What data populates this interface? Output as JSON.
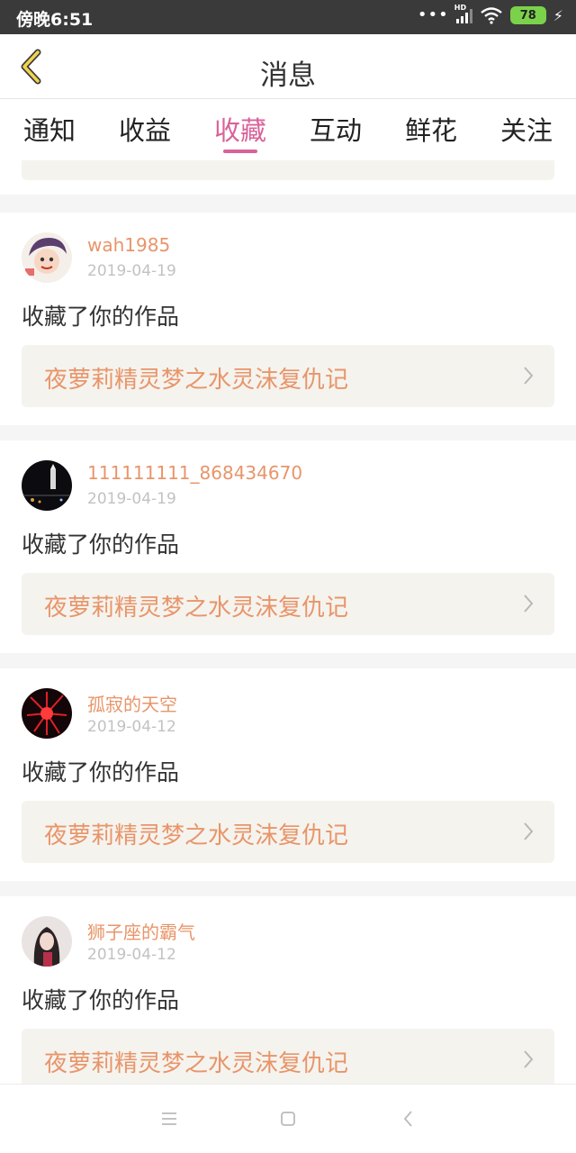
{
  "status": {
    "time": "傍晚6:51",
    "dots": "•••",
    "hd": "HD",
    "battery": "78"
  },
  "header": {
    "title": "消息",
    "back_icon": "chevron-left-icon"
  },
  "tabs": [
    {
      "label": "通知",
      "active": false
    },
    {
      "label": "收益",
      "active": false
    },
    {
      "label": "收藏",
      "active": true
    },
    {
      "label": "互动",
      "active": false
    },
    {
      "label": "鲜花",
      "active": false
    },
    {
      "label": "关注",
      "active": false
    }
  ],
  "accent_colors": {
    "tab_active": "#d9629a",
    "link": "#e8956a"
  },
  "items": [
    {
      "username": "wah1985",
      "date": "2019-04-19",
      "action": "收藏了你的作品",
      "work": "夜萝莉精灵梦之水灵沫复仇记"
    },
    {
      "username": "111111111_868434670",
      "date": "2019-04-19",
      "action": "收藏了你的作品",
      "work": "夜萝莉精灵梦之水灵沫复仇记"
    },
    {
      "username": "孤寂的天空",
      "date": "2019-04-12",
      "action": "收藏了你的作品",
      "work": "夜萝莉精灵梦之水灵沫复仇记"
    },
    {
      "username": "狮子座的霸气",
      "date": "2019-04-12",
      "action": "收藏了你的作品",
      "work": "夜萝莉精灵梦之水灵沫复仇记"
    }
  ],
  "navbar": {
    "icons": [
      "menu-icon",
      "home-icon",
      "back-icon"
    ]
  }
}
